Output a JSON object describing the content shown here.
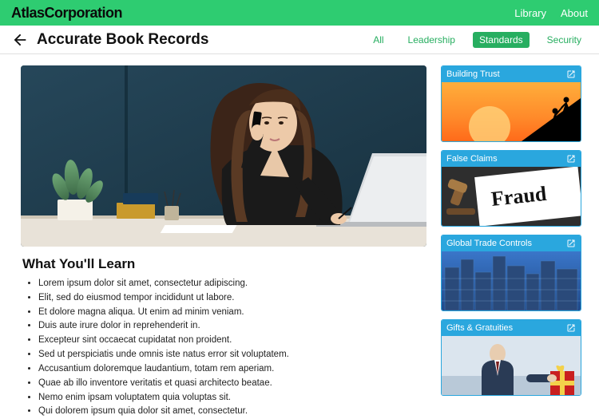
{
  "brand": "AtlasCorporation",
  "topnav": {
    "library": "Library",
    "about": "About"
  },
  "page_title": "Accurate Book Records",
  "tabs": {
    "all": "All",
    "leadership": "Leadership",
    "standards": "Standards",
    "security": "Security"
  },
  "section_title": "What You'll Learn",
  "bullets": [
    "Lorem ipsum dolor sit amet, consectetur adipiscing.",
    "Elit, sed do eiusmod tempor incididunt ut labore.",
    "Et dolore magna aliqua. Ut enim ad minim veniam.",
    "Duis aute irure dolor in reprehenderit in.",
    "Excepteur sint occaecat cupidatat non proident.",
    "Sed ut perspiciatis unde omnis iste natus error sit voluptatem.",
    "Accusantium doloremque laudantium, totam rem aperiam.",
    "Quae ab illo inventore veritatis et quasi architecto beatae.",
    "Nemo enim ipsam voluptatem quia voluptas sit.",
    "Qui dolorem ipsum quia dolor sit amet, consectetur."
  ],
  "cards": [
    {
      "title": "Building Trust"
    },
    {
      "title": "False Claims"
    },
    {
      "title": "Global Trade Controls"
    },
    {
      "title": "Gifts & Gratuities"
    }
  ],
  "colors": {
    "primary": "#2ecc71",
    "accent": "#2aa7de"
  }
}
